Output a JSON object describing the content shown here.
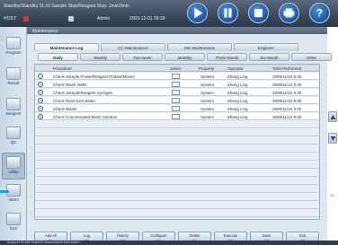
{
  "status": {
    "line1": "Standby/Standby  31:16  Sample Stop/Reagent Stop: 1min/3min",
    "host": "HOST:",
    "user": "Admin",
    "datetime": "2009-12-01  09:18"
  },
  "toolbar": {
    "buttons": [
      {
        "name": "start-button",
        "icon": "play-icon"
      },
      {
        "name": "pause-button",
        "icon": "pause-icon"
      },
      {
        "name": "stop-button",
        "icon": "stop-icon"
      },
      {
        "name": "print-button",
        "icon": "print-icon"
      },
      {
        "name": "help-button",
        "icon": "help-icon"
      }
    ]
  },
  "sidebar": {
    "items": [
      {
        "label": "Program",
        "icon": "program-icon"
      },
      {
        "label": "Result",
        "icon": "result-icon"
      },
      {
        "label": "Reagent",
        "icon": "reagent-icon"
      },
      {
        "label": "QC",
        "icon": "qc-icon"
      },
      {
        "label": "Utility",
        "icon": "utility-icon"
      },
      {
        "label": "Alarm",
        "icon": "alarm-icon"
      },
      {
        "label": "Exit",
        "icon": "exit-icon"
      }
    ]
  },
  "panel": {
    "title": "Maintenance"
  },
  "tabs": [
    "Maintenance Log",
    "CC Maintenance",
    "ISE Maintenance",
    "Engineer"
  ],
  "subtabs": [
    "Daily",
    "Weekly",
    "Two-week",
    "Monthly",
    "Three-Month",
    "Six-Month",
    "Other"
  ],
  "table": {
    "headers": [
      "Procedure",
      "Select",
      "Property",
      "Operator",
      "Time Performed"
    ],
    "rows": [
      {
        "num": "1",
        "procedure": "Check Sample Probe/Reagent Probes/Mixers",
        "property": "System",
        "operator": "Zhang Ling",
        "time": "2009/11/10 8:30"
      },
      {
        "num": "2",
        "procedure": "Check Wash Wells",
        "property": "System",
        "operator": "Zhang Ling",
        "time": "2009/11/10 8:30"
      },
      {
        "num": "3",
        "procedure": "Check Sample/Reagent Syringes",
        "property": "System",
        "operator": "Zhang Ling",
        "time": "2009/11/10 8:30"
      },
      {
        "num": "4",
        "procedure": "Check Deionized Water",
        "property": "System",
        "operator": "Zhang Ling",
        "time": "2009/11/10 8:30"
      },
      {
        "num": "5",
        "procedure": "Check Waste",
        "property": "System",
        "operator": "Zhang Ling",
        "time": "2009/11/10 8:30"
      },
      {
        "num": "6",
        "procedure": "Check Concentrated Wash Solution",
        "property": "System",
        "operator": "Zhang Ling",
        "time": "2009/11/10 8:30"
      }
    ]
  },
  "scroll": {
    "label": "1/1"
  },
  "fbuttons": [
    {
      "label": "Add All",
      "key": "F1"
    },
    {
      "label": "Log",
      "key": "F2"
    },
    {
      "label": "History",
      "key": "F3"
    },
    {
      "label": "Configure",
      "key": "F4"
    },
    {
      "label": "Delete",
      "key": "F5"
    },
    {
      "label": "Execute",
      "key": "F6"
    },
    {
      "label": "Save",
      "key": "F7"
    },
    {
      "label": "Exit",
      "key": "F8"
    }
  ],
  "footer": {
    "text": "Analyzer ID  with serial  ID  maintenance information"
  }
}
